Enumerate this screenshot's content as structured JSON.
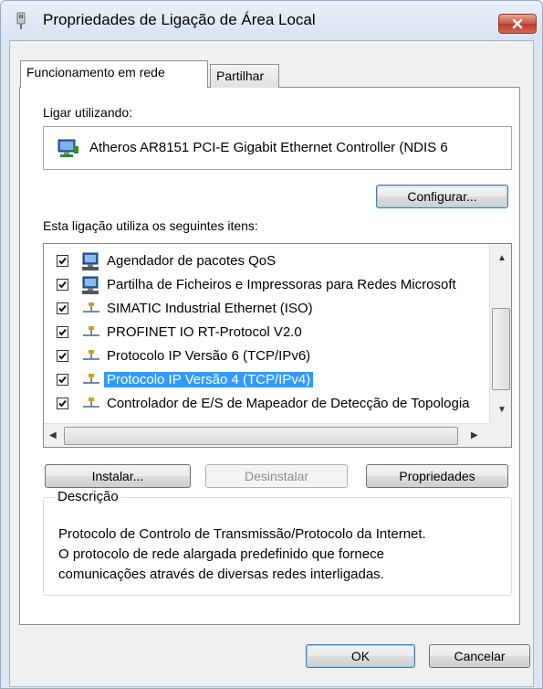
{
  "window": {
    "title": "Propriedades de Ligação de Área Local"
  },
  "tabs": [
    {
      "label": "Funcionamento em rede",
      "active": true
    },
    {
      "label": "Partilhar",
      "active": false
    }
  ],
  "connect_using": {
    "label": "Ligar utilizando:",
    "adapter": "Atheros AR8151 PCI-E Gigabit Ethernet Controller (NDIS 6",
    "configure_label": "Configurar..."
  },
  "items_section": {
    "label": "Esta ligação utiliza os seguintes itens:",
    "items": [
      {
        "label": "Agendador de pacotes QoS",
        "checked": true,
        "icon": "network-client-icon",
        "selected": false
      },
      {
        "label": "Partilha de Ficheiros e Impressoras para Redes Microsoft",
        "checked": true,
        "icon": "network-client-icon",
        "selected": false
      },
      {
        "label": "SIMATIC Industrial Ethernet (ISO)",
        "checked": true,
        "icon": "protocol-icon",
        "selected": false
      },
      {
        "label": "PROFINET IO RT-Protocol V2.0",
        "checked": true,
        "icon": "protocol-icon",
        "selected": false
      },
      {
        "label": "Protocolo IP Versão 6 (TCP/IPv6)",
        "checked": true,
        "icon": "protocol-icon",
        "selected": false
      },
      {
        "label": "Protocolo IP Versão 4 (TCP/IPv4)",
        "checked": true,
        "icon": "protocol-icon",
        "selected": true
      },
      {
        "label": "Controlador de E/S de Mapeador de Detecção de Topologia",
        "checked": true,
        "icon": "protocol-icon",
        "selected": false
      }
    ]
  },
  "actions": {
    "install": "Instalar...",
    "uninstall": "Desinstalar",
    "properties": "Propriedades"
  },
  "description": {
    "legend": "Descrição",
    "text_line1": "Protocolo de Controlo de Transmissão/Protocolo da Internet.",
    "text_line2": "O protocolo de rede alargada predefinido que fornece",
    "text_line3": "comunicações através de diversas redes interligadas."
  },
  "footer": {
    "ok": "OK",
    "cancel": "Cancelar"
  },
  "colors": {
    "selection": "#3399ff",
    "close_button": "#c85443",
    "title_bar": "#dbe6f3"
  }
}
